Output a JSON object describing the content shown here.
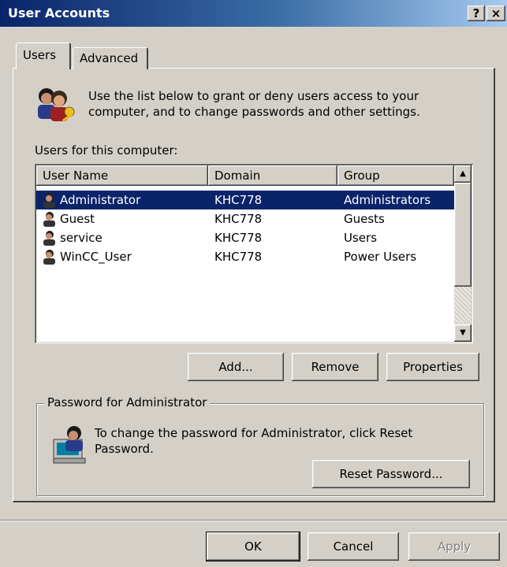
{
  "window": {
    "title": "User Accounts",
    "help_btn": "?",
    "close_btn": "×"
  },
  "tabs": [
    {
      "label": "Users",
      "active": true
    },
    {
      "label": "Advanced",
      "active": false
    }
  ],
  "intro_text": "Use the list below to grant or deny users access to your computer, and to change passwords and other settings.",
  "list_label": "Users for this computer:",
  "columns": [
    "User Name",
    "Domain",
    "Group"
  ],
  "users": [
    {
      "name": "Administrator",
      "domain": "KHC778",
      "group": "Administrators",
      "selected": true
    },
    {
      "name": "Guest",
      "domain": "KHC778",
      "group": "Guests",
      "selected": false
    },
    {
      "name": "service",
      "domain": "KHC778",
      "group": "Users",
      "selected": false
    },
    {
      "name": "WinCC_User",
      "domain": "KHC778",
      "group": "Power Users",
      "selected": false
    }
  ],
  "list_buttons": {
    "add": "Add...",
    "remove": "Remove",
    "properties": "Properties"
  },
  "password_group": {
    "title": "Password for Administrator",
    "text": "To change the password for Administrator, click Reset Password.",
    "reset_button": "Reset Password..."
  },
  "dialog_buttons": {
    "ok": "OK",
    "cancel": "Cancel",
    "apply": "Apply"
  },
  "colors": {
    "selection": "#0a246a",
    "face": "#d4d0c8",
    "title_start": "#0a246a"
  }
}
